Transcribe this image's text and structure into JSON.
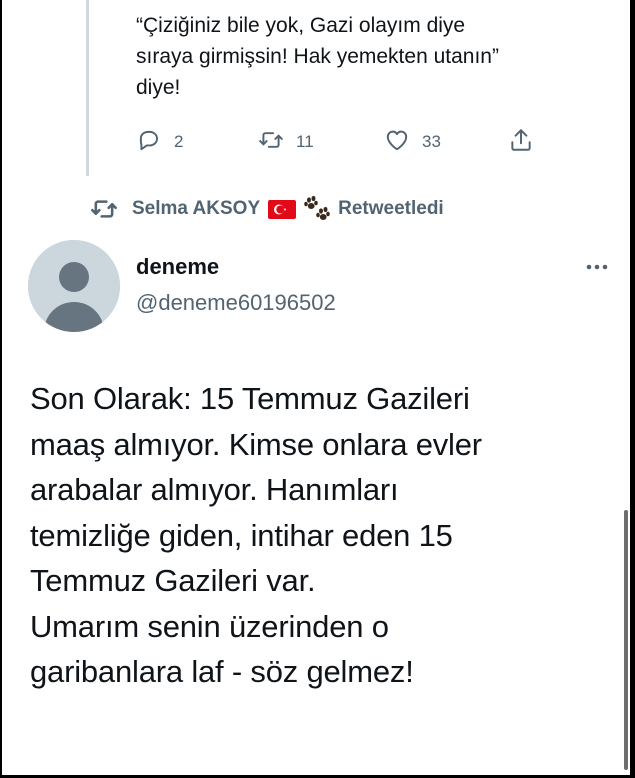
{
  "previous_tweet": {
    "text_lines": [
      "“Çiziğiniz bile yok, Gazi olayım diye",
      "sıraya girmişsin! Hak yemekten utanın”",
      "diye!"
    ],
    "actions": {
      "reply_count": "2",
      "retweet_count": "11",
      "like_count": "33"
    }
  },
  "retweet_banner": {
    "name": "Selma AKSOY",
    "suffix": "Retweetledi"
  },
  "tweet": {
    "display_name": "deneme",
    "handle": "@deneme60196502",
    "text_lines": [
      "Son Olarak: 15 Temmuz Gazileri",
      "maaş almıyor. Kimse onlara evler",
      "arabalar almıyor. Hanımları",
      "temizliğe giden, intihar eden 15",
      "Temmuz Gazileri var.",
      "Umarım senin üzerinden o",
      "garibanlara laf - söz gelmez!"
    ]
  },
  "icons": {
    "reply": "reply-icon",
    "retweet": "retweet-icon",
    "like": "heart-icon",
    "share": "share-icon",
    "more": "more-icon",
    "flag": "turkey-flag-icon",
    "paws": "paw-prints-icon"
  },
  "colors": {
    "text": "#0f1419",
    "secondary": "#536471",
    "thread_line": "#cfd9de",
    "avatar_bg": "#ccd6dd"
  }
}
